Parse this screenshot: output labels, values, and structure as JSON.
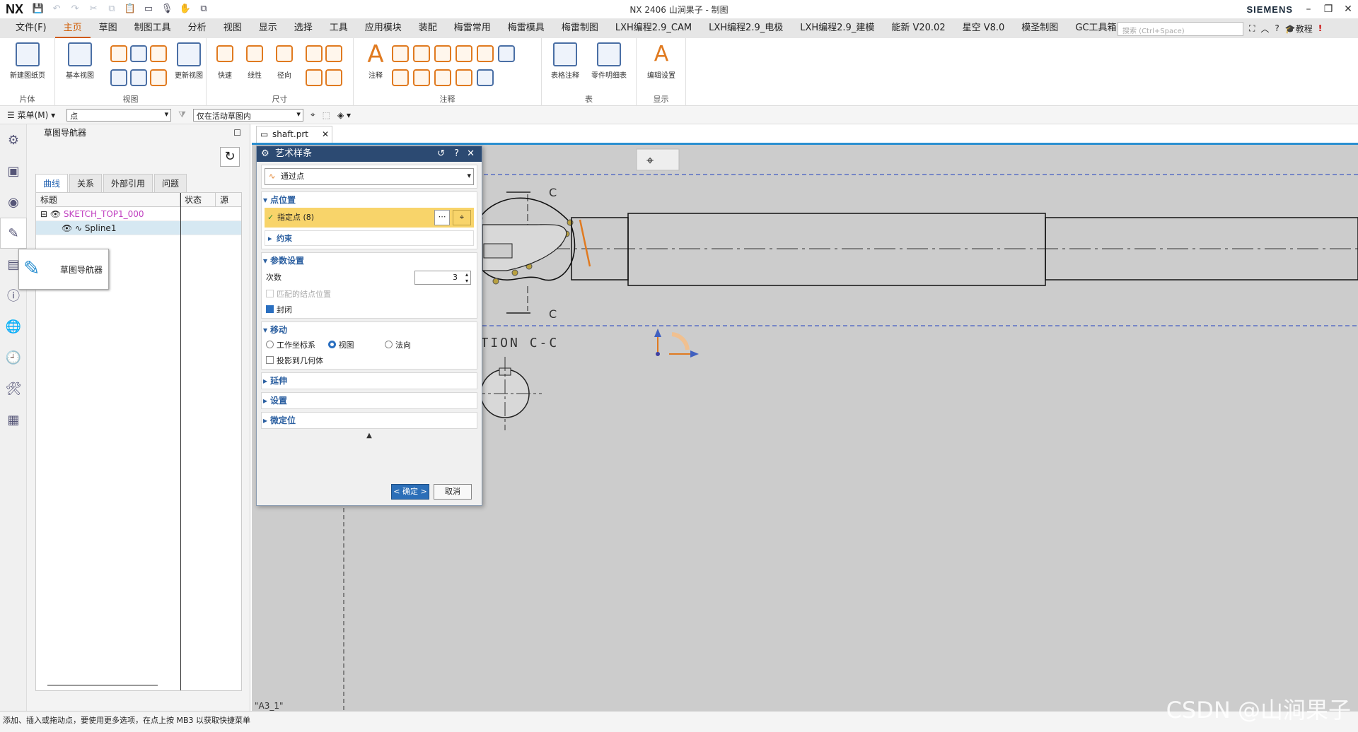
{
  "titlebar": {
    "logo": "NX",
    "title": "NX 2406 山涧果子 - 制图",
    "brand": "SIEMENS"
  },
  "menubar": {
    "items": [
      "文件(F)",
      "主页",
      "草图",
      "制图工具",
      "分析",
      "视图",
      "显示",
      "选择",
      "工具",
      "应用模块",
      "装配",
      "梅雷常用",
      "梅雷模具",
      "梅雷制图",
      "LXH编程2.9_CAM",
      "LXH编程2.9_电极",
      "LXH编程2.9_建模",
      "能新 V20.02",
      "星空 V8.0",
      "模圣制图",
      "GC工具箱"
    ],
    "active": "主页",
    "search_placeholder": "搜索 (Ctrl+Space)",
    "tutorial": "教程"
  },
  "ribbon": {
    "groups": {
      "sheet": "片体",
      "view": "视图",
      "dimension": "尺寸",
      "annotation": "注释",
      "table": "表",
      "display": "显示"
    },
    "buttons": {
      "new_sheet": "新建图纸页",
      "base_view": "基本视图",
      "update_view": "更新视图",
      "quick": "快速",
      "linear": "线性",
      "radial": "径向",
      "note": "注释",
      "tabular_note": "表格注释",
      "parts_list": "零件明细表",
      "edit_settings": "编辑设置"
    }
  },
  "selbar": {
    "menu": "菜单(M)",
    "filter": "点",
    "scope": "仅在活动草图内"
  },
  "navigator": {
    "title": "草图导航器",
    "tabs": [
      "曲线",
      "关系",
      "外部引用",
      "问题"
    ],
    "columns": [
      "标题",
      "状态",
      "源"
    ],
    "tree": [
      {
        "label": "SKETCH_TOP1_000"
      },
      {
        "label": "Spline1"
      }
    ],
    "tooltip": "草图导航器"
  },
  "doc_tab": "shaft.prt",
  "dialog": {
    "title": "艺术样条",
    "type_value": "通过点",
    "sections": {
      "point_location": "点位置",
      "specify_point": "指定点 (8)",
      "constraints": "约束",
      "parameters": "参数设置",
      "degree_label": "次数",
      "degree_value": "3",
      "match_knots": "匹配的结点位置",
      "closed": "封闭",
      "move": "移动",
      "wcs": "工作坐标系",
      "view": "视图",
      "normal": "法向",
      "project": "投影到几何体",
      "extend": "延伸",
      "settings": "设置",
      "fine_position": "微定位"
    },
    "ok": "< 确定 >",
    "cancel": "取消"
  },
  "drawing": {
    "section_label": "SECTION  C-C",
    "cut_label_top": "C",
    "cut_label_bottom": "C",
    "sheet_name": "\"A3_1\""
  },
  "status": "添加、插入或拖动点，要使用更多选项，在点上按 MB3 以获取快捷菜单",
  "watermark": "CSDN @山涧果子",
  "colors": {
    "accent": "#d05a00",
    "dialog_header": "#2c4a72",
    "highlight_row": "#f8d46a",
    "gfx_bg": "#cccccc"
  }
}
